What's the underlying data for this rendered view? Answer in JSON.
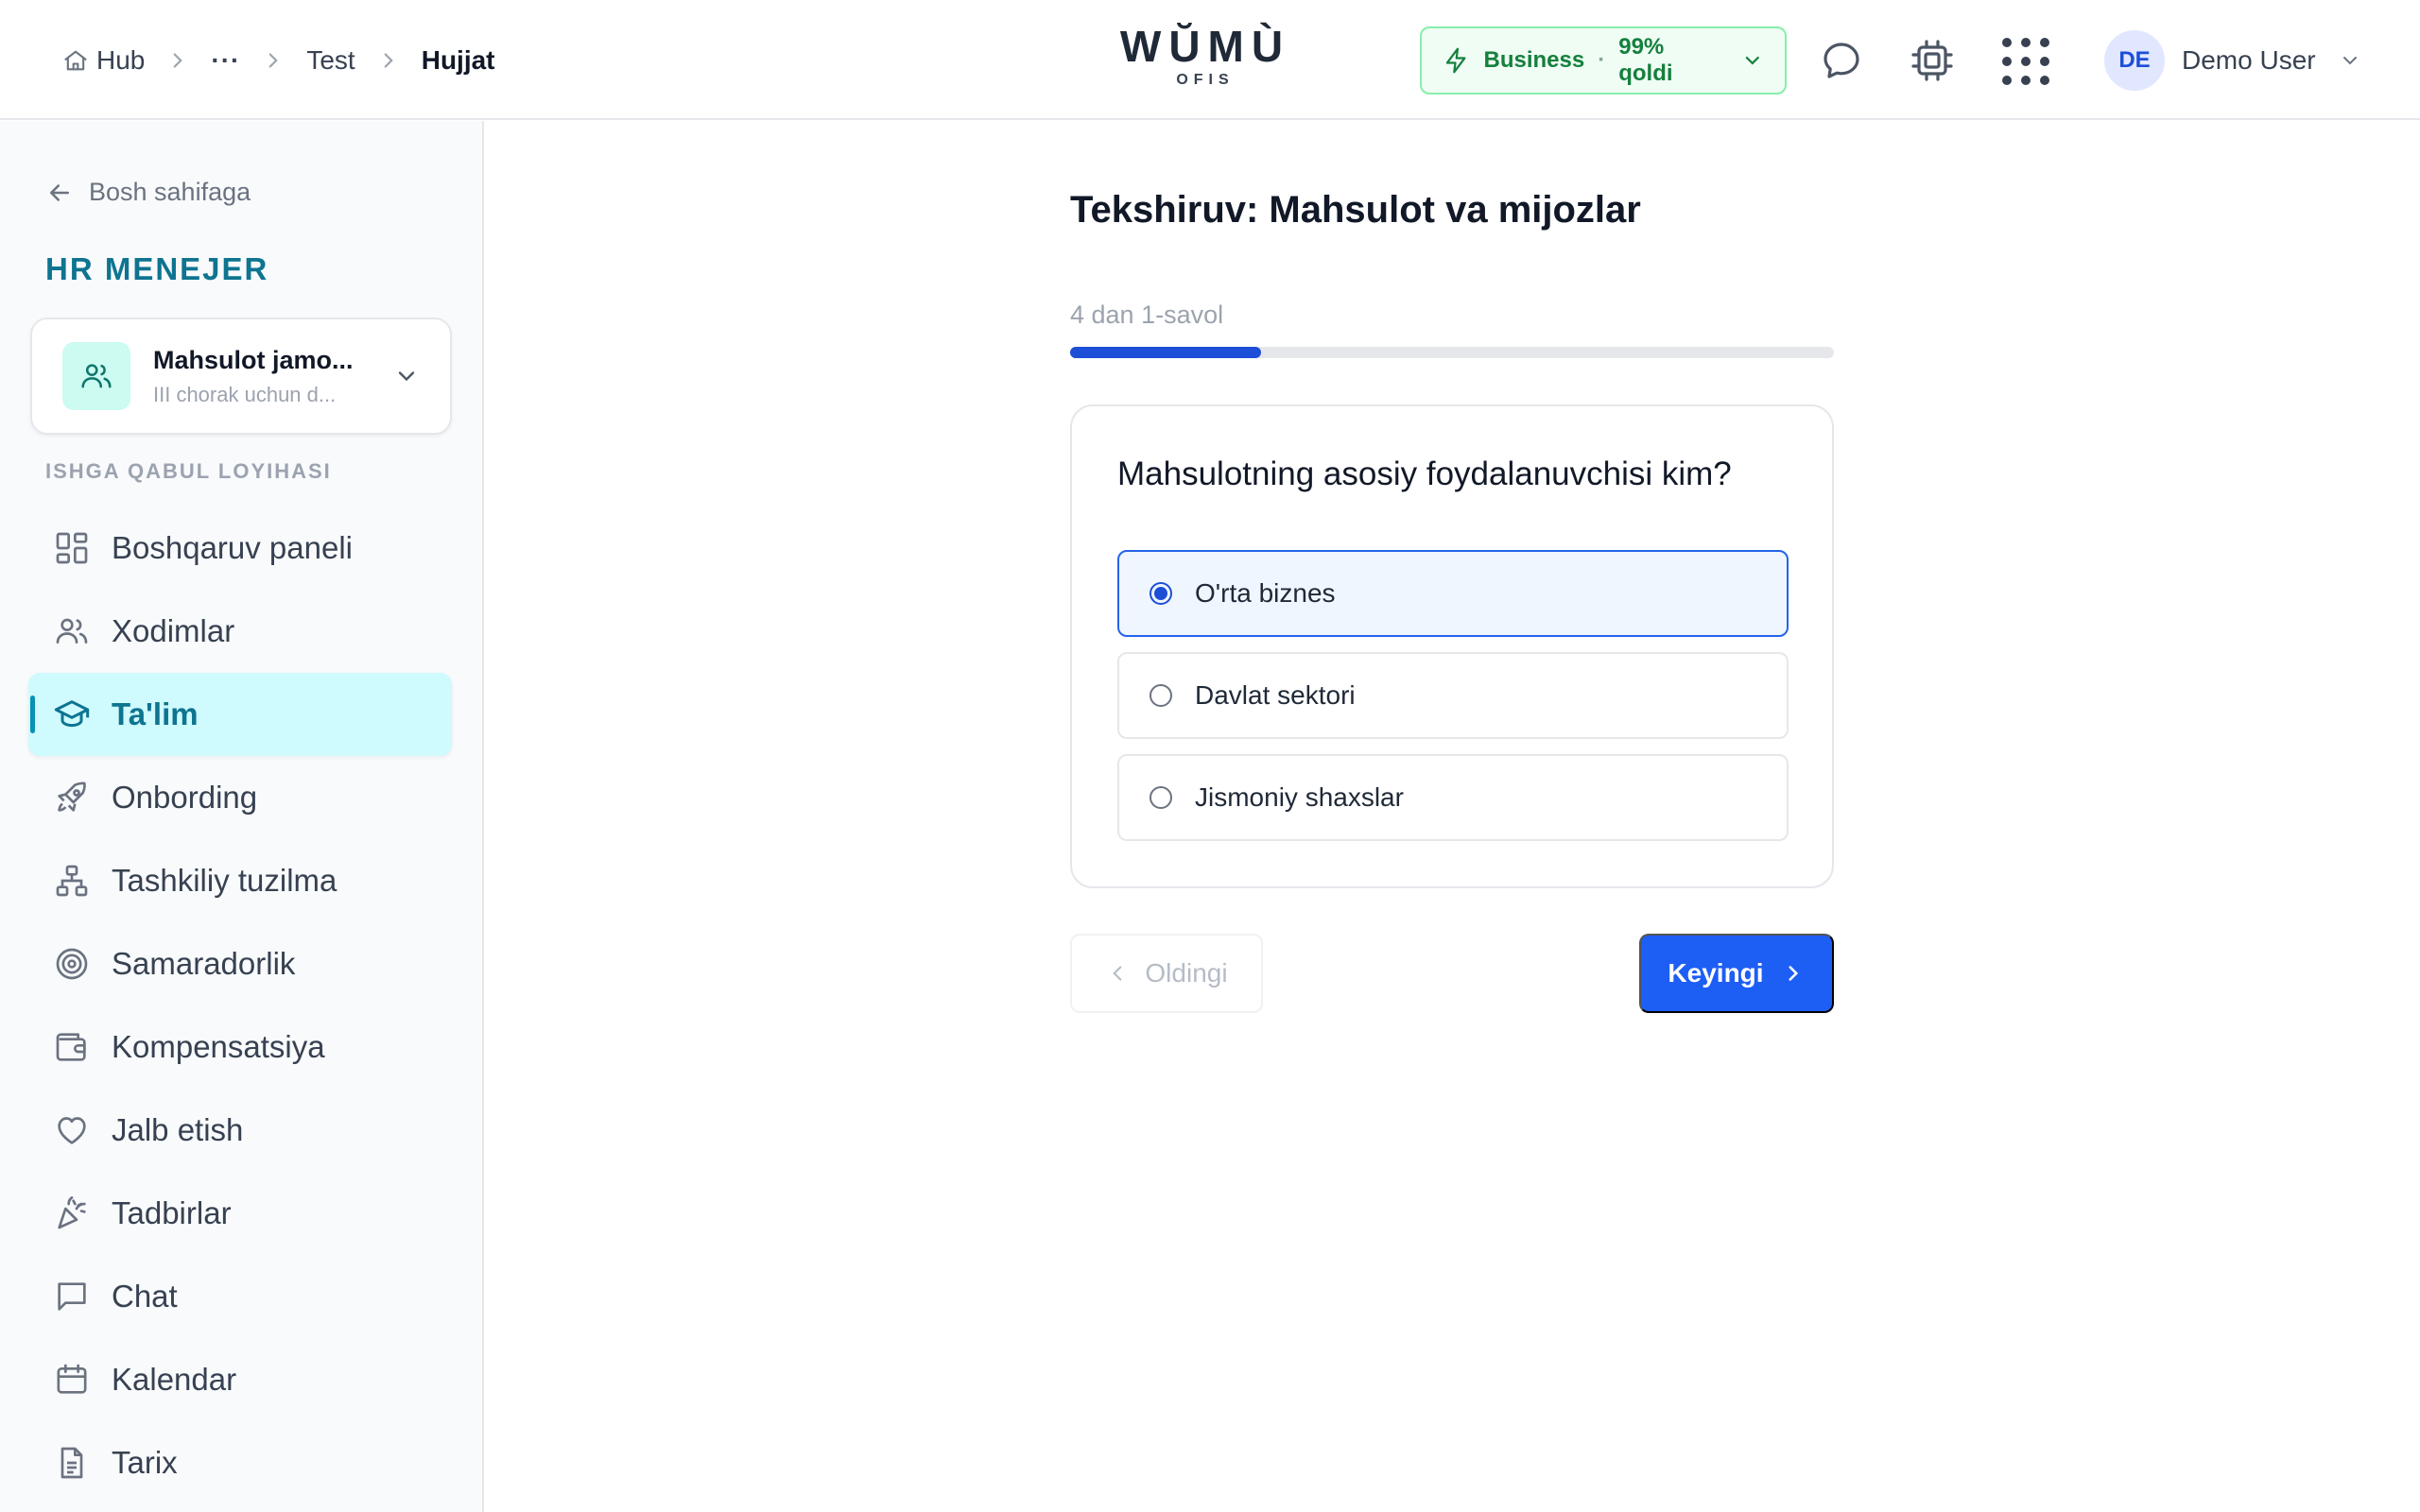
{
  "breadcrumb": {
    "hub": "Hub",
    "ellipsis": "···",
    "test": "Test",
    "current": "Hujjat"
  },
  "logo": {
    "main": "WŬMÙ",
    "sub": "OFIS"
  },
  "plan": {
    "name": "Business",
    "separator": "·",
    "remaining": "99% qoldi",
    "color": "#15803d"
  },
  "header_icons": [
    "chat-bubble-icon",
    "cpu-chip-icon",
    "apps-grid-icon"
  ],
  "user": {
    "initials": "DE",
    "name": "Demo User"
  },
  "sidebar": {
    "back_label": "Bosh sahifaga",
    "module_title": "HR MENEJER",
    "team": {
      "name": "Mahsulot jamo...",
      "subtitle": "III chorak uchun d..."
    },
    "section_label": "ISHGA QABUL LOYIHASI",
    "items": [
      {
        "label": "Boshqaruv paneli",
        "icon": "dashboard-icon"
      },
      {
        "label": "Xodimlar",
        "icon": "users-icon"
      },
      {
        "label": "Ta'lim",
        "icon": "graduation-cap-icon",
        "active": true
      },
      {
        "label": "Onbording",
        "icon": "rocket-icon"
      },
      {
        "label": "Tashkiliy tuzilma",
        "icon": "org-chart-icon"
      },
      {
        "label": "Samaradorlik",
        "icon": "target-icon"
      },
      {
        "label": "Kompensatsiya",
        "icon": "wallet-icon"
      },
      {
        "label": "Jalb etish",
        "icon": "heart-icon"
      },
      {
        "label": "Tadbirlar",
        "icon": "party-popper-icon"
      },
      {
        "label": "Chat",
        "icon": "chat-icon"
      },
      {
        "label": "Kalendar",
        "icon": "calendar-icon"
      },
      {
        "label": "Tarix",
        "icon": "document-icon"
      }
    ],
    "accent_color": "#0e7490"
  },
  "quiz": {
    "title": "Tekshiruv: Mahsulot va mijozlar",
    "progress_label": "4 dan 1-savol",
    "progress_fraction": 0.25,
    "question": "Mahsulotning asosiy foydalanuvchisi kim?",
    "options": [
      {
        "label": "O'rta biznes",
        "selected": true
      },
      {
        "label": "Davlat sektori",
        "selected": false
      },
      {
        "label": "Jismoniy shaxslar",
        "selected": false
      }
    ],
    "prev_label": "Oldingi",
    "next_label": "Keyingi",
    "primary_color": "#1d5ef5"
  }
}
